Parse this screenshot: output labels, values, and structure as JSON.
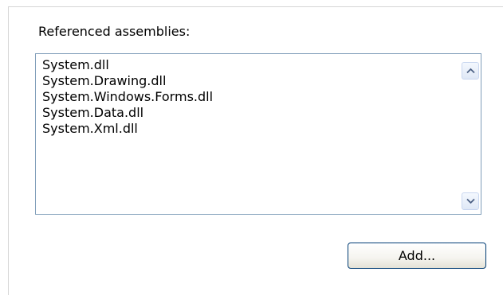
{
  "group": {
    "label": "Referenced assemblies:"
  },
  "assemblies": [
    "System.dll",
    "System.Drawing.dll",
    "System.Windows.Forms.dll",
    "System.Data.dll",
    "System.Xml.dll"
  ],
  "buttons": {
    "add_label": "Add..."
  },
  "icons": {
    "scroll_up": "chevron-up-icon",
    "scroll_down": "chevron-down-icon"
  },
  "colors": {
    "list_border": "#7f9db9",
    "button_border": "#003c74",
    "scroll_arrow": "#4d6185"
  }
}
